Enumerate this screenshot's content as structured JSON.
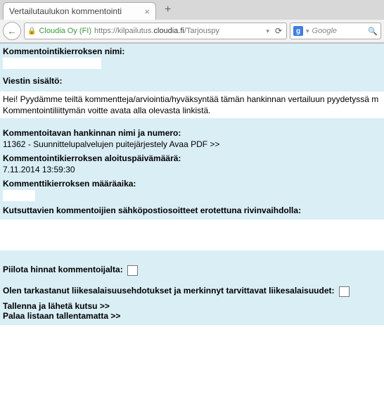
{
  "browser": {
    "tab_title": "Vertailutaulukon kommentointi",
    "newtab_glyph": "+",
    "back_glyph": "←",
    "lock_glyph": "🔒",
    "identity": "Cloudia Oy (FI)",
    "url_prefix": "https://kilpailutus.",
    "url_host": "cloudia.fi",
    "url_path": "/Tarjouspy",
    "reload_glyph": "⟳",
    "search_engine_glyph": "g",
    "search_placeholder": "Google",
    "search_icon": "🔍",
    "dropdown_glyph": "▾"
  },
  "form": {
    "round_name_label": "Kommentointikierroksen nimi:",
    "message_label": "Viestin sisältö:",
    "message_line1": "Hei! Pyydämme teiltä kommentteja/arviointia/hyväksyntää tämän hankinnan vertailuun pyydetyssä m",
    "message_line2": "Kommentointiliittymän voitte avata alla olevasta linkistä.",
    "target_label": "Kommentoitavan hankinnan nimi ja numero:",
    "target_value": "11362 - Suunnittelupalvelujen puitejärjestely Avaa PDF >>",
    "start_label": "Kommentointikierroksen aloituspäivämäärä:",
    "start_value": "7.11.2014 13:59:30",
    "deadline_label": "Kommenttikierroksen määräaika:",
    "emails_label": "Kutsuttavien kommentoijien sähköpostiosoitteet erotettuna rivinvaihdolla:",
    "hide_prices_label": "Piilota hinnat kommentoijalta:",
    "confirm_label": "Olen tarkastanut liikesalaisuusehdotukset ja merkinnyt tarvittavat liikesalaisuudet:",
    "save_send": "Tallenna ja lähetä kutsu >>",
    "back_link": "Palaa listaan tallentamatta >>"
  }
}
